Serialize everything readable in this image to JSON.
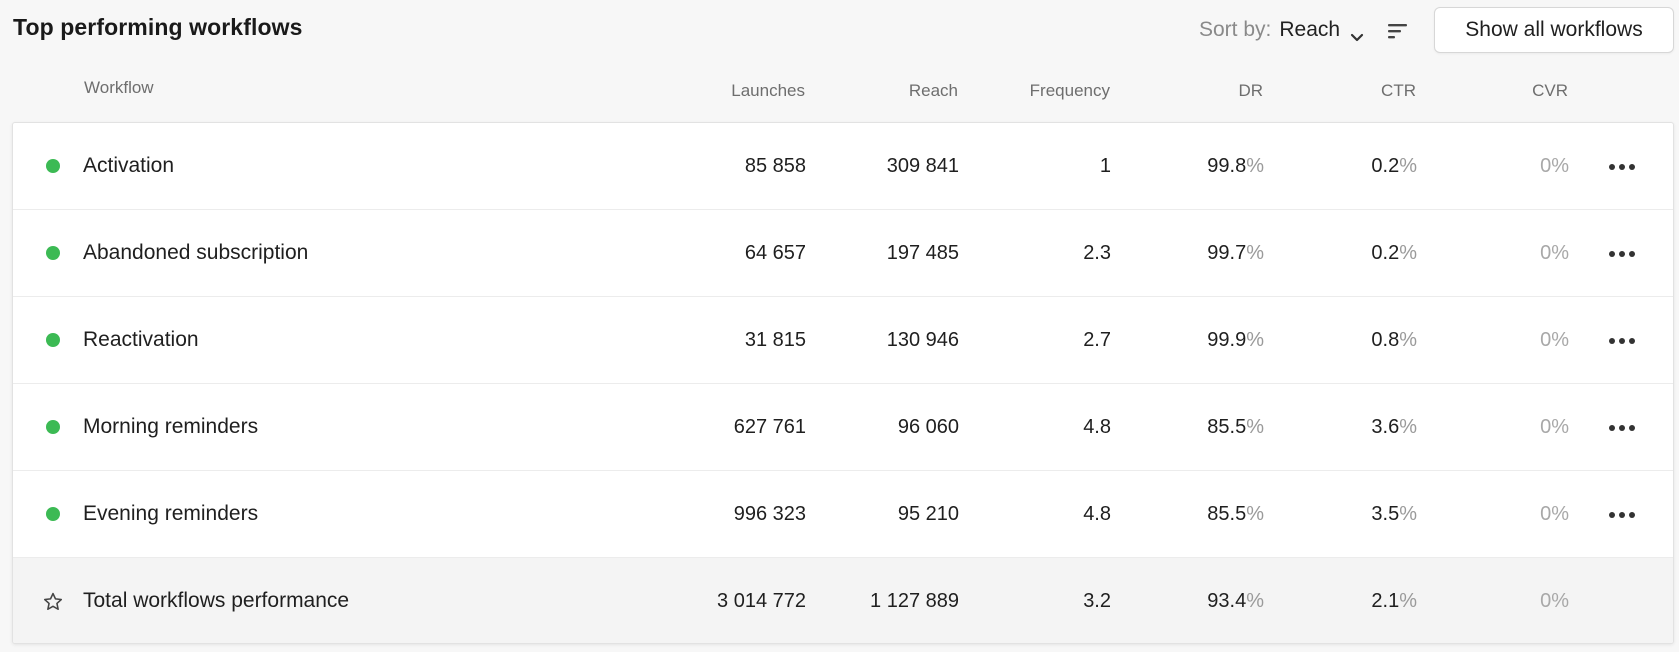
{
  "header": {
    "title": "Top performing workflows",
    "sort_label": "Sort by:",
    "sort_value": "Reach",
    "show_all_label": "Show all workflows"
  },
  "columns": {
    "workflow": "Workflow",
    "launches": "Launches",
    "reach": "Reach",
    "frequency": "Frequency",
    "dr": "DR",
    "ctr": "CTR",
    "cvr": "CVR"
  },
  "colors": {
    "status_active": "#3cba54",
    "accent_text": "#1f1f1f",
    "muted_text": "#9a9a9a"
  },
  "rows": [
    {
      "name": "Activation",
      "status": "active",
      "launches": "85 858",
      "reach": "309 841",
      "frequency": "1",
      "dr": "99.8",
      "ctr": "0.2",
      "cvr": "0%"
    },
    {
      "name": "Abandoned subscription",
      "status": "active",
      "launches": "64 657",
      "reach": "197 485",
      "frequency": "2.3",
      "dr": "99.7",
      "ctr": "0.2",
      "cvr": "0%"
    },
    {
      "name": "Reactivation",
      "status": "active",
      "launches": "31 815",
      "reach": "130 946",
      "frequency": "2.7",
      "dr": "99.9",
      "ctr": "0.8",
      "cvr": "0%"
    },
    {
      "name": "Morning reminders",
      "status": "active",
      "launches": "627 761",
      "reach": "96 060",
      "frequency": "4.8",
      "dr": "85.5",
      "ctr": "3.6",
      "cvr": "0%"
    },
    {
      "name": "Evening reminders",
      "status": "active",
      "launches": "996 323",
      "reach": "95 210",
      "frequency": "4.8",
      "dr": "85.5",
      "ctr": "3.5",
      "cvr": "0%"
    }
  ],
  "total": {
    "name": "Total workflows performance",
    "icon": "star-icon",
    "launches": "3 014 772",
    "reach": "1 127 889",
    "frequency": "3.2",
    "dr": "93.4",
    "ctr": "2.1",
    "cvr": "0%"
  },
  "percent_sign": "%"
}
